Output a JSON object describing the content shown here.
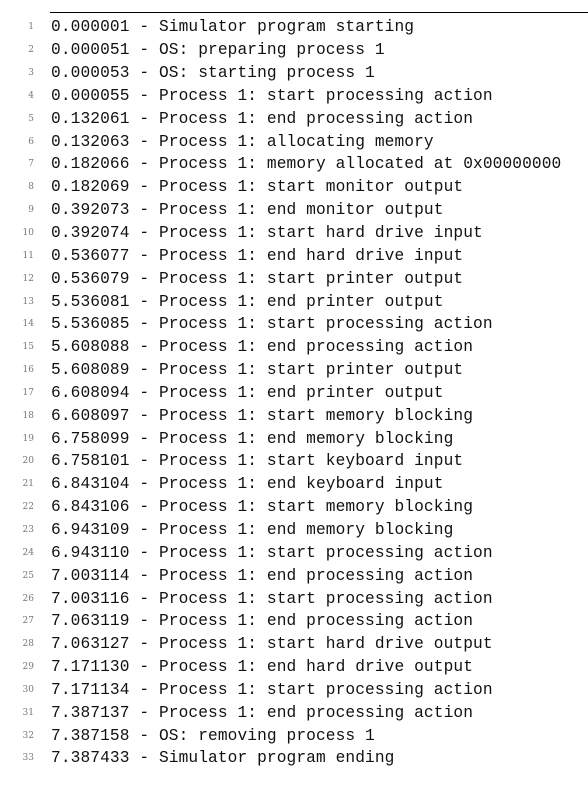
{
  "lines": [
    "0.000001 - Simulator program starting",
    "0.000051 - OS: preparing process 1",
    "0.000053 - OS: starting process 1",
    "0.000055 - Process 1: start processing action",
    "0.132061 - Process 1: end processing action",
    "0.132063 - Process 1: allocating memory",
    "0.182066 - Process 1: memory allocated at 0x00000000",
    "0.182069 - Process 1: start monitor output",
    "0.392073 - Process 1: end monitor output",
    "0.392074 - Process 1: start hard drive input",
    "0.536077 - Process 1: end hard drive input",
    "0.536079 - Process 1: start printer output",
    "5.536081 - Process 1: end printer output",
    "5.536085 - Process 1: start processing action",
    "5.608088 - Process 1: end processing action",
    "5.608089 - Process 1: start printer output",
    "6.608094 - Process 1: end printer output",
    "6.608097 - Process 1: start memory blocking",
    "6.758099 - Process 1: end memory blocking",
    "6.758101 - Process 1: start keyboard input",
    "6.843104 - Process 1: end keyboard input",
    "6.843106 - Process 1: start memory blocking",
    "6.943109 - Process 1: end memory blocking",
    "6.943110 - Process 1: start processing action",
    "7.003114 - Process 1: end processing action",
    "7.003116 - Process 1: start processing action",
    "7.063119 - Process 1: end processing action",
    "7.063127 - Process 1: start hard drive output",
    "7.171130 - Process 1: end hard drive output",
    "7.171134 - Process 1: start processing action",
    "7.387137 - Process 1: end processing action",
    "7.387158 - OS: removing process 1",
    "7.387433 - Simulator program ending"
  ]
}
